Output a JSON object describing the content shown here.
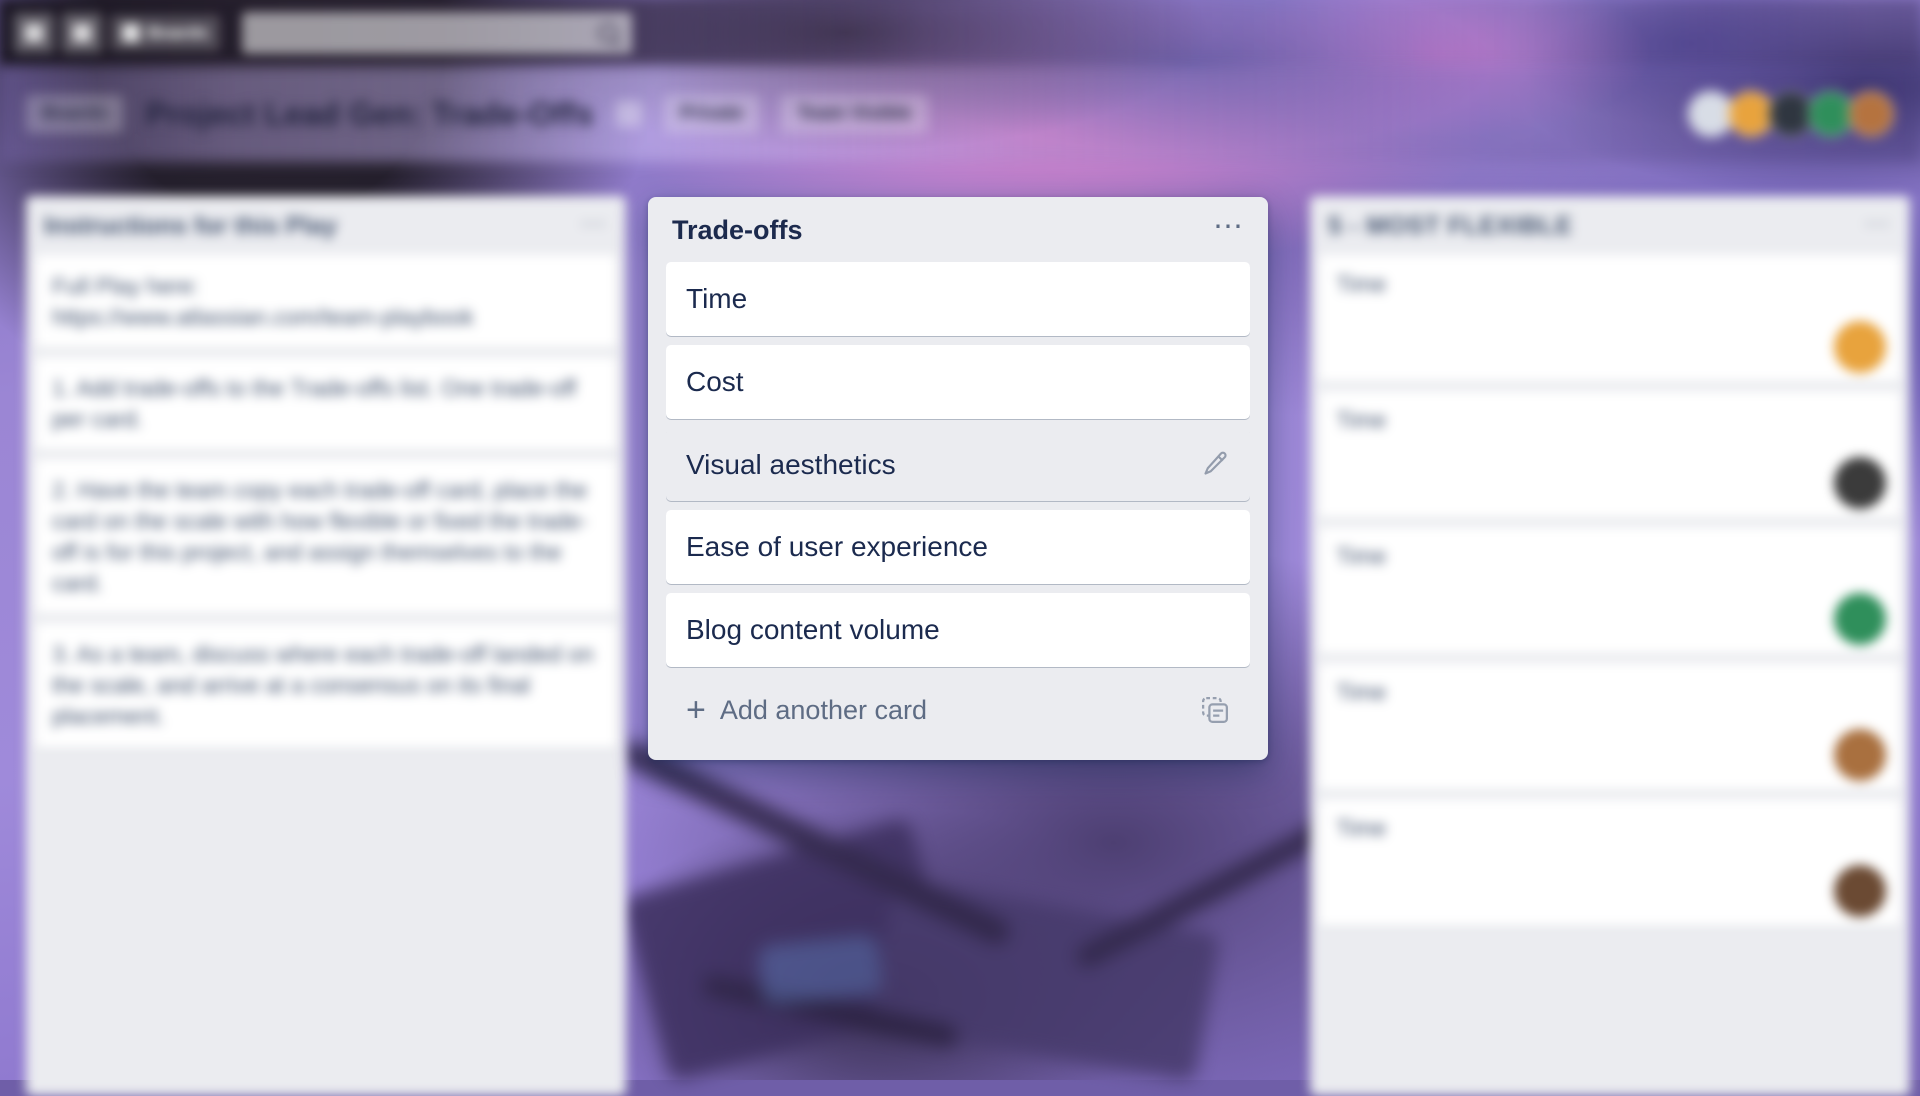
{
  "app": {
    "name": "Trello",
    "accent_color": "#0079bf",
    "board_surface_color": "#ebecf0",
    "card_color": "#ffffff",
    "text_color": "#172b4d",
    "muted_text_color": "#5e6c84"
  },
  "top_nav": {
    "buttons": [
      {
        "name": "apps-grid-icon",
        "label": ""
      },
      {
        "name": "home-icon",
        "label": ""
      }
    ],
    "boards_button": {
      "label": "Boards",
      "icon": "boards-icon"
    },
    "search": {
      "value": "",
      "placeholder": "",
      "icon": "search-icon"
    }
  },
  "board_header": {
    "back_label": "Boards",
    "title": "Project Lead Gen: Trade-Offs",
    "star_icon": "star-icon",
    "visibility_label": "Private",
    "team_label": "Team Visible",
    "members": [
      {
        "name": "member-avatar-1",
        "color": "#d8dde6"
      },
      {
        "name": "member-avatar-2",
        "color": "#e8a33d"
      },
      {
        "name": "member-avatar-3",
        "color": "#2f3640"
      },
      {
        "name": "member-avatar-4",
        "color": "#2f8f5b"
      },
      {
        "name": "member-avatar-5",
        "color": "#b5733f"
      }
    ]
  },
  "lists": [
    {
      "id": "instructions",
      "title": "Instructions for this Play",
      "menu_icon": "list-menu-icon",
      "cards": [
        {
          "text": "Full Play here:\nhttps://www.atlassian.com/team-playbook"
        },
        {
          "text": "1. Add trade-offs to the Trade-offs list. One trade-off per card."
        },
        {
          "text": "2. Have the team copy each trade-off card, place the card on the scale with how flexible or fixed the trade-off is for this project, and assign themselves to the card."
        },
        {
          "text": "3. As a team, discuss where each trade-off landed on the scale, and arrive at a consensus on its final placement."
        }
      ]
    },
    {
      "id": "tradeoffs",
      "title": "Trade-offs",
      "menu_icon": "list-menu-icon",
      "focused": true,
      "cards": [
        {
          "text": "Time",
          "hover": false,
          "edit_icon": null
        },
        {
          "text": "Cost",
          "hover": false,
          "edit_icon": null
        },
        {
          "text": "Visual aesthetics",
          "hover": true,
          "edit_icon": "edit-pencil-icon"
        },
        {
          "text": "Ease of user experience",
          "hover": false,
          "edit_icon": null
        },
        {
          "text": "Blog content volume",
          "hover": false,
          "edit_icon": null
        }
      ],
      "add_card": {
        "label": "Add another card",
        "plus_icon": "plus-icon",
        "template_icon": "card-template-icon"
      }
    },
    {
      "id": "most-flexible",
      "title": "5 - MOST FLEXIBLE",
      "menu_icon": "list-menu-icon",
      "cards": [
        {
          "text": "Time",
          "avatar": {
            "name": "card-avatar-1",
            "color": "#e8a33d"
          }
        },
        {
          "text": "Time",
          "avatar": {
            "name": "card-avatar-2",
            "color": "#3b3b3b"
          }
        },
        {
          "text": "Time",
          "avatar": {
            "name": "card-avatar-3",
            "color": "#2f8f5b"
          }
        },
        {
          "text": "Time",
          "avatar": {
            "name": "card-avatar-4",
            "color": "#a9703f"
          }
        },
        {
          "text": "Time",
          "avatar": {
            "name": "card-avatar-5",
            "color": "#6b4a33"
          }
        }
      ]
    }
  ]
}
